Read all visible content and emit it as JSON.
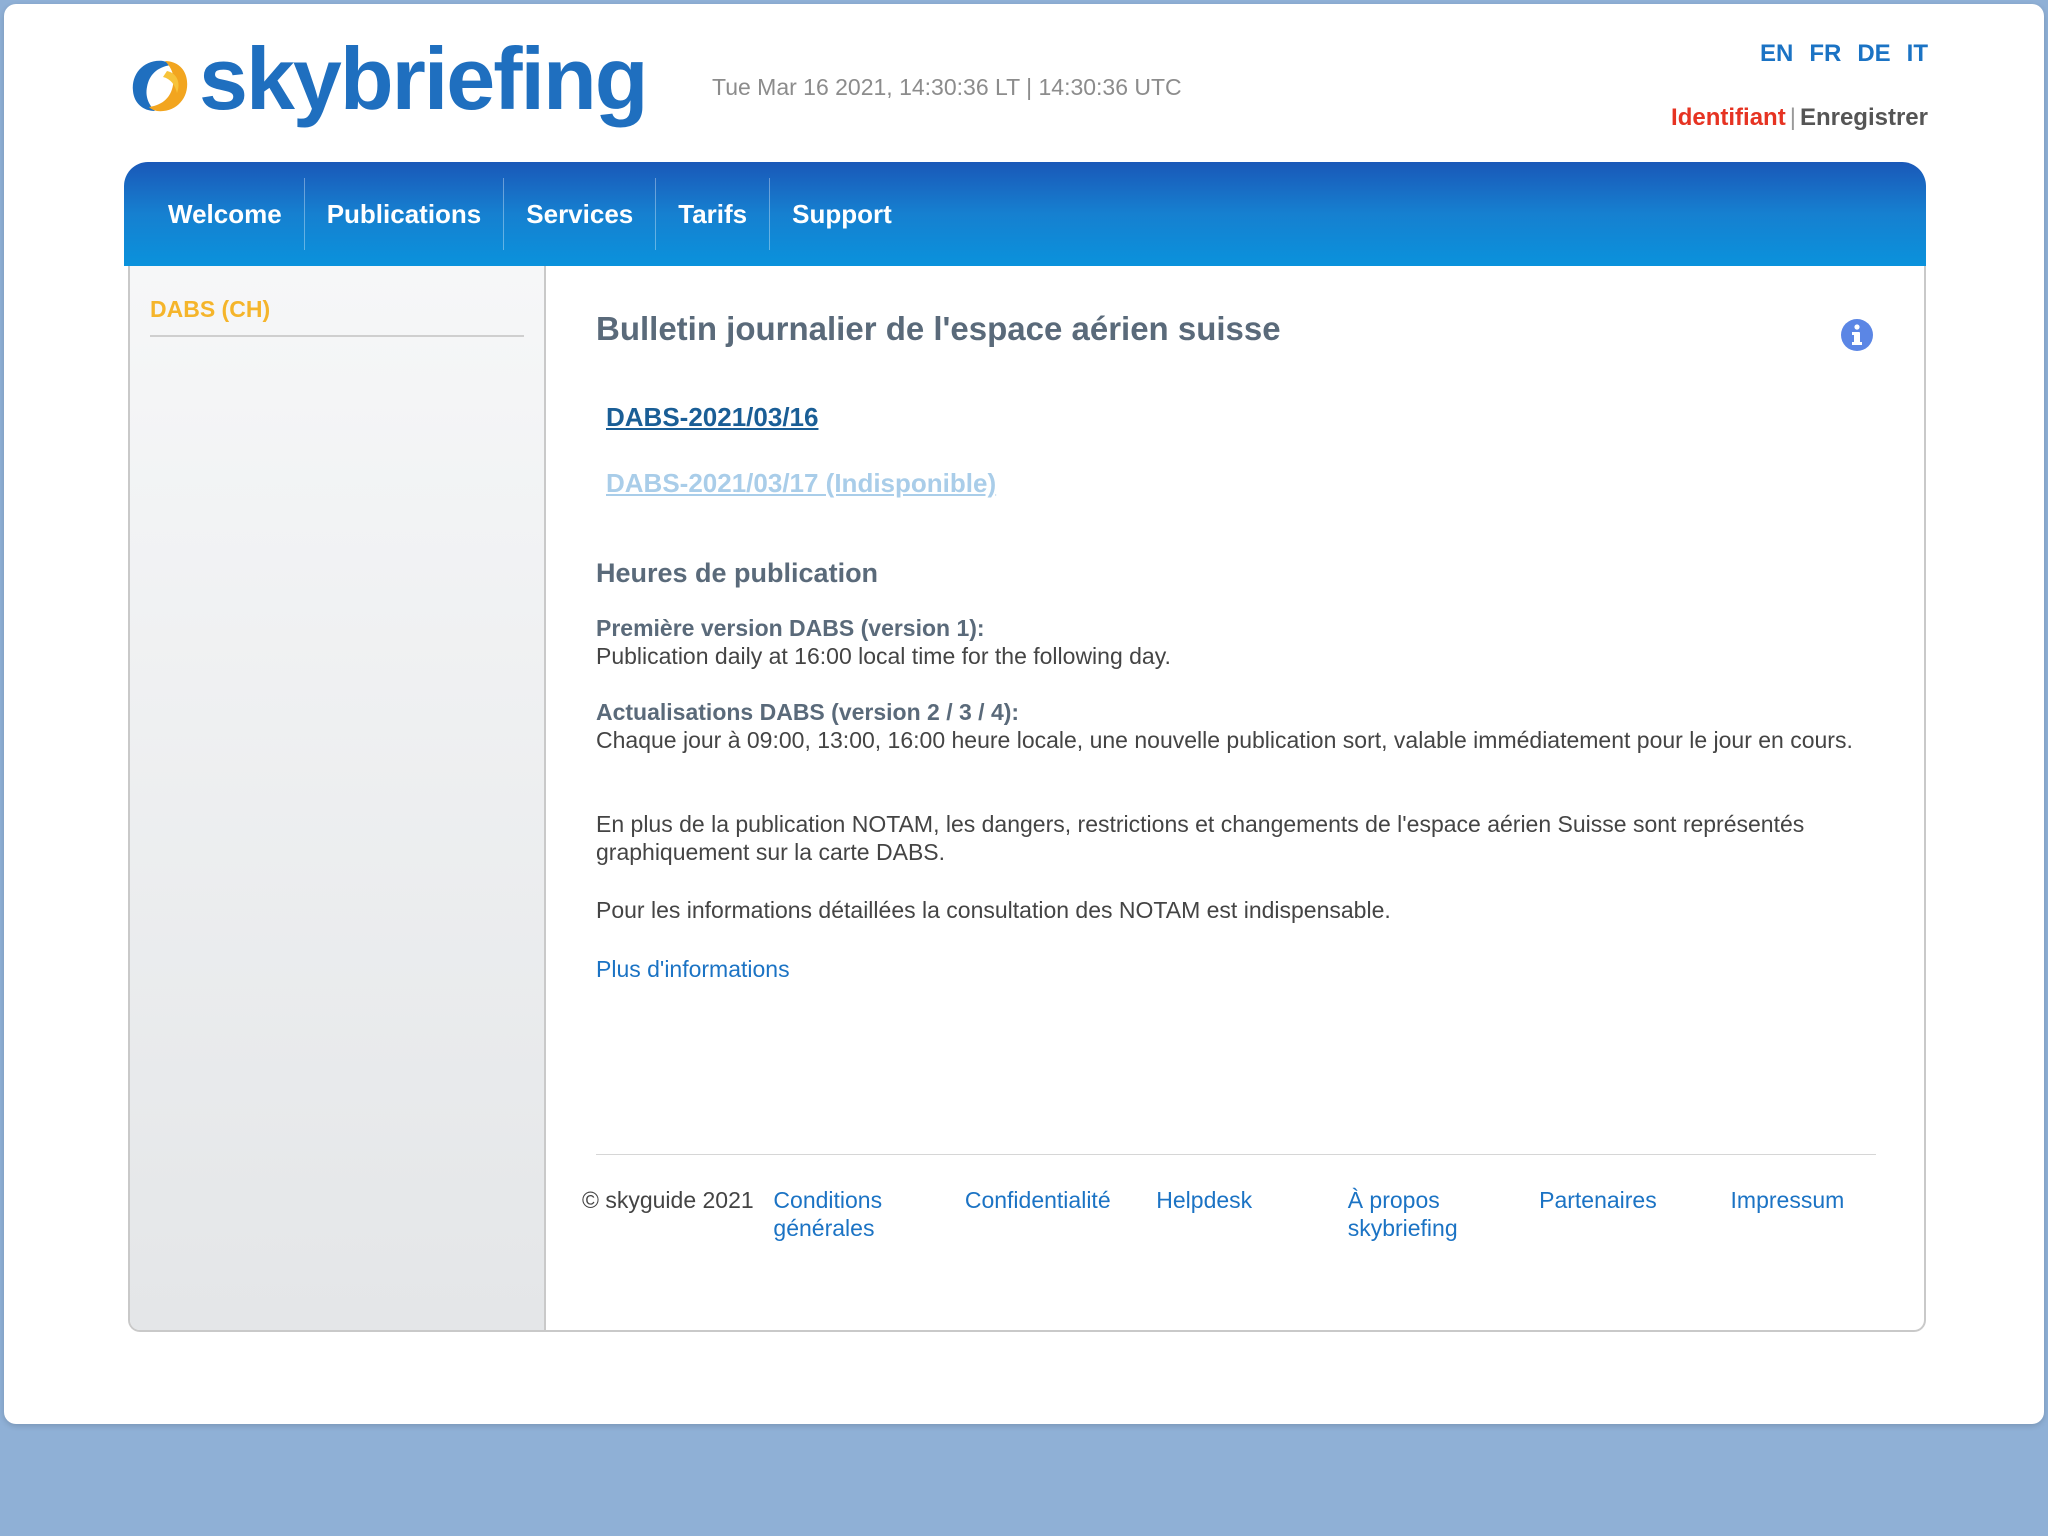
{
  "header": {
    "logo_text": "skybriefing",
    "datetime": "Tue Mar 16 2021, 14:30:36 LT | 14:30:36 UTC",
    "languages": [
      "EN",
      "FR",
      "DE",
      "IT"
    ],
    "login_label": "Identifiant",
    "separator": "|",
    "register_label": "Enregistrer"
  },
  "nav": {
    "items": [
      "Welcome",
      "Publications",
      "Services",
      "Tarifs",
      "Support"
    ]
  },
  "sidebar": {
    "items": [
      {
        "label": "DABS (CH)"
      }
    ]
  },
  "main": {
    "title": "Bulletin journalier de l'espace aérien suisse",
    "info_icon": "info-icon",
    "dabs_links": [
      {
        "label": "DABS-2021/03/16",
        "available": true
      },
      {
        "label": "DABS-2021/03/17 (Indisponible)",
        "available": false
      }
    ],
    "section_title": "Heures de publication",
    "first_version_heading": "Première version DABS (version 1):",
    "first_version_text": "Publication daily at 16:00 local time for the following day.",
    "updates_heading": "Actualisations DABS (version 2 / 3 / 4):",
    "updates_text": "Chaque jour à 09:00, 13:00, 16:00 heure locale, une nouvelle publication sort, valable immédiatement pour le jour en cours.",
    "paragraph_notam": "En plus de la publication NOTAM, les dangers, restrictions et changements de l'espace aérien Suisse sont représentés graphiquement sur la carte DABS.",
    "paragraph_detail": "Pour les informations détaillées la consultation des NOTAM est indispensable.",
    "more_link": "Plus d'informations"
  },
  "footer": {
    "copyright": "© skyguide 2021",
    "links": [
      "Conditions générales",
      "Confidentialité",
      "Helpdesk",
      "À propos skybriefing",
      "Partenaires",
      "Impressum"
    ]
  },
  "colors": {
    "brand_blue": "#1b73c4",
    "nav_gradient_top": "#1a58b8",
    "nav_gradient_bottom": "#0a92dc",
    "login_red": "#e63322",
    "sidebar_active": "#f5b52b",
    "background": "#8fb0d6"
  }
}
